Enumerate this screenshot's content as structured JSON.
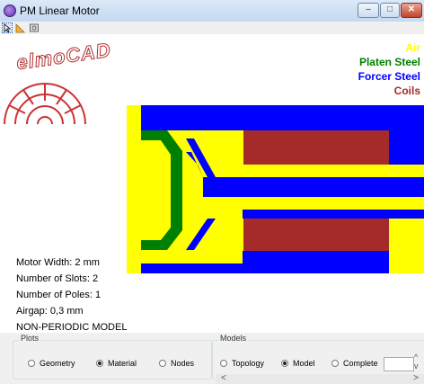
{
  "window": {
    "title": "PM Linear Motor",
    "minimize": "–",
    "maximize": "□",
    "close": "✕"
  },
  "toolbar": {
    "tools": [
      "select-tool",
      "measure-tool",
      "zoom-tool"
    ]
  },
  "logo": {
    "text": "elmoCAD"
  },
  "legend": [
    {
      "label": "Air",
      "color": "#ffff00"
    },
    {
      "label": "Platen Steel",
      "color": "#008000"
    },
    {
      "label": "Forcer Steel",
      "color": "#0000ff"
    },
    {
      "label": "Coils",
      "color": "#a52a2a"
    }
  ],
  "info": {
    "width": "Motor Width: 2 mm",
    "slots": "Number of Slots: 2",
    "poles": "Number of Poles: 1",
    "airgap": "Airgap: 0,3 mm",
    "model": "NON-PERIODIC MODEL"
  },
  "plots": {
    "title": "Plots",
    "options": [
      "Geometry",
      "Material",
      "Nodes"
    ],
    "selected": "Material"
  },
  "models": {
    "title": "Models",
    "options": [
      "Topology",
      "Model",
      "Complete"
    ],
    "selected": "Model"
  },
  "scroll": {
    "left_arrow": "<",
    "right_arrow": ">",
    "up_arrow": "^",
    "down_arrow": "v"
  }
}
